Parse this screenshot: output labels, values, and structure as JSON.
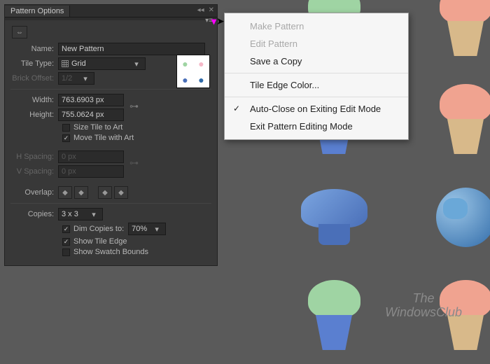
{
  "panel": {
    "title": "Pattern Options",
    "name_label": "Name:",
    "name_value": "New Pattern",
    "tile_type_label": "Tile Type:",
    "tile_type_value": "Grid",
    "brick_offset_label": "Brick Offset:",
    "brick_offset_value": "1/2",
    "width_label": "Width:",
    "width_value": "763.6903 px",
    "height_label": "Height:",
    "height_value": "755.0624 px",
    "size_tile_label": "Size Tile to Art",
    "move_tile_label": "Move Tile with Art",
    "h_spacing_label": "H Spacing:",
    "h_spacing_value": "0 px",
    "v_spacing_label": "V Spacing:",
    "v_spacing_value": "0 px",
    "overlap_label": "Overlap:",
    "copies_label": "Copies:",
    "copies_value": "3 x 3",
    "dim_copies_label": "Dim Copies to:",
    "dim_copies_value": "70%",
    "show_tile_edge_label": "Show Tile Edge",
    "show_swatch_label": "Show Swatch Bounds",
    "checks": {
      "size_tile": false,
      "move_tile": true,
      "dim_copies": true,
      "show_tile_edge": true,
      "show_swatch": false
    }
  },
  "flyout": {
    "make_pattern": "Make Pattern",
    "edit_pattern": "Edit Pattern",
    "save_copy": "Save a Copy",
    "tile_edge_color": "Tile Edge Color...",
    "auto_close": "Auto-Close on Exiting Edit Mode",
    "exit_mode": "Exit Pattern Editing Mode"
  },
  "watermark": {
    "line1": "The",
    "line2": "WindowsClub"
  },
  "colors": {
    "frost_green": "#9fd4a3",
    "frost_pink": "#f5b8c8",
    "frost_coral": "#f0a390",
    "wrap_blue": "#5a7fd0",
    "wrap_tan": "#d8b98a",
    "hat_blue1": "#7ba5e0",
    "hat_blue2": "#4a6fb8"
  }
}
